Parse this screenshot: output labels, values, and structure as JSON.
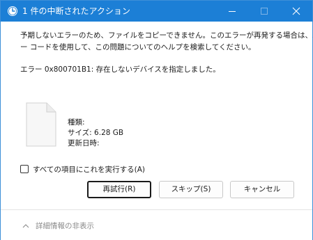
{
  "window": {
    "title": "1 件の中断されたアクション",
    "icon": "clock-icon",
    "accent_color": "#1c7fd6",
    "controls": [
      "minimize-icon",
      "maximize-icon",
      "close-icon"
    ]
  },
  "message": {
    "line1": "予期しないエラーのため、ファイルをコピーできません。このエラーが再発する場合は、エラ",
    "line2": "ー コードを使用して、この問題についてのヘルプを検索してください。"
  },
  "error": {
    "text": "エラー 0x800701B1: 存在しないデバイスを指定しました。"
  },
  "file": {
    "icon": "file-icon",
    "type_label": "種類:",
    "size_label": "サイズ: 6.28 GB",
    "modified_label": "更新日時:"
  },
  "apply_all": {
    "label": "すべての項目にこれを実行する(A)",
    "checked": false
  },
  "buttons": {
    "retry": "再試行(R)",
    "skip": "スキップ(S)",
    "cancel": "キャンセル"
  },
  "footer": {
    "details_label": "詳細情報の非表示",
    "icon": "chevron-up-icon"
  }
}
